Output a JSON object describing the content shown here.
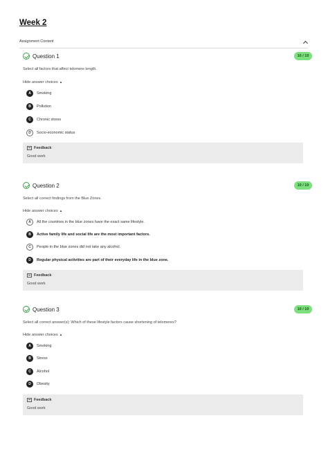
{
  "page": {
    "title": "Week 2"
  },
  "content_bar": {
    "label": "Assignment Content"
  },
  "questions": [
    {
      "title": "Question 1",
      "score": "10 / 10",
      "prompt": "Select all factors that affect telomere length.",
      "toggle": "Hide answer choices",
      "choices": [
        {
          "letter": "A",
          "text": "Smoking",
          "selected": true
        },
        {
          "letter": "B",
          "text": "Pollution",
          "selected": true
        },
        {
          "letter": "C",
          "text": "Chronic stress",
          "selected": true
        },
        {
          "letter": "D",
          "text": "Socio-economic status",
          "selected": false
        }
      ],
      "feedback": {
        "label": "Feedback",
        "text": "Good work"
      }
    },
    {
      "title": "Question 2",
      "score": "10 / 10",
      "prompt": "Select all correct findings from the Blue Zones.",
      "toggle": "Hide answer choices",
      "choices": [
        {
          "letter": "A",
          "text": "All the countries in the blue zones have the exact same lifestyle.",
          "selected": false
        },
        {
          "letter": "B",
          "text": "Active family life and social life are the most important factors.",
          "selected": true
        },
        {
          "letter": "C",
          "text": "People in the blue zones did not take any alcohol.",
          "selected": false
        },
        {
          "letter": "D",
          "text": "Regular physical activities are part of their everyday life in the blue zone.",
          "selected": true
        }
      ],
      "feedback": {
        "label": "Feedback",
        "text": "Good work"
      }
    },
    {
      "title": "Question 3",
      "score": "10 / 10",
      "prompt": "Select all correct answer(s): Which of these lifestyle factors cause shortening of telomeres?",
      "toggle": "Hide answer choices",
      "choices": [
        {
          "letter": "A",
          "text": "Smoking",
          "selected": true
        },
        {
          "letter": "B",
          "text": "Stress",
          "selected": true
        },
        {
          "letter": "C",
          "text": "Alcohol",
          "selected": true
        },
        {
          "letter": "D",
          "text": "Obesity",
          "selected": true
        }
      ],
      "feedback": {
        "label": "Feedback",
        "text": "Good work"
      }
    }
  ],
  "colors": {
    "correct": "#3d9a4a",
    "score_badge": "#7ddf7d",
    "selected_choice": "#222222",
    "feedback_bg": "#ebebeb"
  },
  "icons": {
    "status": "check-circle-icon",
    "collapse": "chevron-up-icon",
    "feedback": "feedback-icon"
  }
}
